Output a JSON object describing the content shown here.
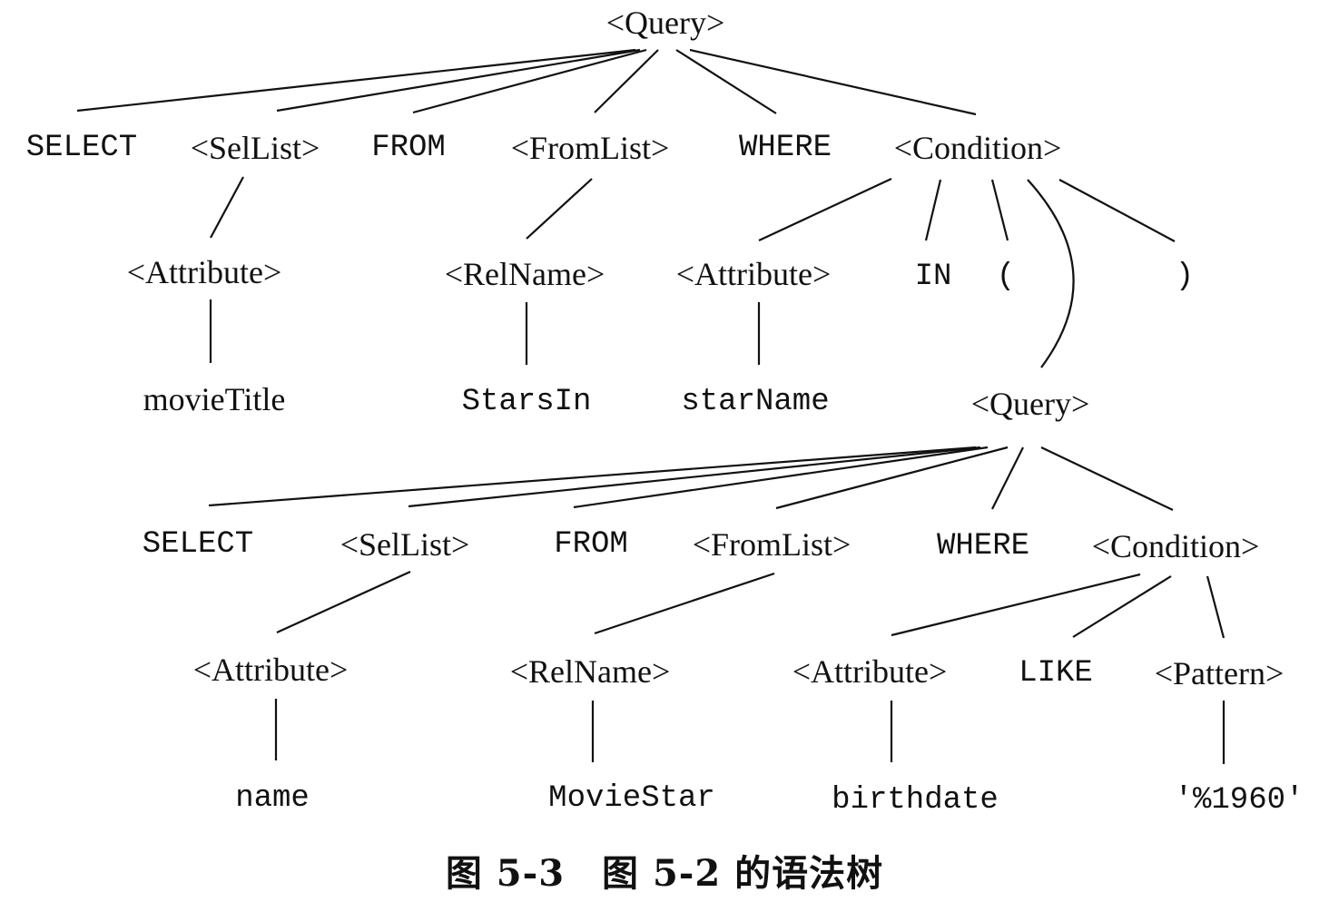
{
  "tree": {
    "nodes": [
      {
        "id": "q1",
        "text": "<Query>",
        "font": "serif"
      },
      {
        "id": "select1",
        "text": "SELECT",
        "font": "mono"
      },
      {
        "id": "sellist1",
        "text": "<SelList>",
        "font": "serif"
      },
      {
        "id": "from1",
        "text": "FROM",
        "font": "mono"
      },
      {
        "id": "fromlist1",
        "text": "<FromList>",
        "font": "serif"
      },
      {
        "id": "where1",
        "text": "WHERE",
        "font": "mono"
      },
      {
        "id": "cond1",
        "text": "<Condition>",
        "font": "serif"
      },
      {
        "id": "attr1",
        "text": "<Attribute>",
        "font": "serif"
      },
      {
        "id": "relname1",
        "text": "<RelName>",
        "font": "serif"
      },
      {
        "id": "attr2",
        "text": "<Attribute>",
        "font": "serif"
      },
      {
        "id": "in1",
        "text": "IN",
        "font": "mono"
      },
      {
        "id": "lparen",
        "text": "(",
        "font": "mono"
      },
      {
        "id": "rparen",
        "text": ")",
        "font": "mono"
      },
      {
        "id": "movietitle",
        "text": "movieTitle",
        "font": "serif"
      },
      {
        "id": "starsin",
        "text": "StarsIn",
        "font": "mono"
      },
      {
        "id": "starname",
        "text": "starName",
        "font": "mono"
      },
      {
        "id": "q2",
        "text": "<Query>",
        "font": "serif"
      },
      {
        "id": "select2",
        "text": "SELECT",
        "font": "mono"
      },
      {
        "id": "sellist2",
        "text": "<SelList>",
        "font": "serif"
      },
      {
        "id": "from2",
        "text": "FROM",
        "font": "mono"
      },
      {
        "id": "fromlist2",
        "text": "<FromList>",
        "font": "serif"
      },
      {
        "id": "where2",
        "text": "WHERE",
        "font": "mono"
      },
      {
        "id": "cond2",
        "text": "<Condition>",
        "font": "serif"
      },
      {
        "id": "attr3",
        "text": "<Attribute>",
        "font": "serif"
      },
      {
        "id": "relname2",
        "text": "<RelName>",
        "font": "serif"
      },
      {
        "id": "attr4",
        "text": "<Attribute>",
        "font": "serif"
      },
      {
        "id": "like1",
        "text": "LIKE",
        "font": "mono"
      },
      {
        "id": "pattern1",
        "text": "<Pattern>",
        "font": "serif"
      },
      {
        "id": "name1",
        "text": "name",
        "font": "mono"
      },
      {
        "id": "moviestar",
        "text": "MovieStar",
        "font": "mono"
      },
      {
        "id": "birthdate",
        "text": "birthdate",
        "font": "mono"
      },
      {
        "id": "patternval",
        "text": "'%1960'",
        "font": "mono"
      }
    ],
    "edges": [
      [
        "q1",
        "select1"
      ],
      [
        "q1",
        "sellist1"
      ],
      [
        "q1",
        "from1"
      ],
      [
        "q1",
        "fromlist1"
      ],
      [
        "q1",
        "where1"
      ],
      [
        "q1",
        "cond1"
      ],
      [
        "sellist1",
        "attr1"
      ],
      [
        "attr1",
        "movietitle"
      ],
      [
        "fromlist1",
        "relname1"
      ],
      [
        "relname1",
        "starsin"
      ],
      [
        "cond1",
        "attr2"
      ],
      [
        "cond1",
        "in1"
      ],
      [
        "cond1",
        "lparen"
      ],
      [
        "cond1",
        "q2"
      ],
      [
        "cond1",
        "rparen"
      ],
      [
        "attr2",
        "starname"
      ],
      [
        "q2",
        "select2"
      ],
      [
        "q2",
        "sellist2"
      ],
      [
        "q2",
        "from2"
      ],
      [
        "q2",
        "fromlist2"
      ],
      [
        "q2",
        "where2"
      ],
      [
        "q2",
        "cond2"
      ],
      [
        "sellist2",
        "attr3"
      ],
      [
        "attr3",
        "name1"
      ],
      [
        "fromlist2",
        "relname2"
      ],
      [
        "relname2",
        "moviestar"
      ],
      [
        "cond2",
        "attr4"
      ],
      [
        "cond2",
        "like1"
      ],
      [
        "cond2",
        "pattern1"
      ],
      [
        "attr4",
        "birthdate"
      ],
      [
        "pattern1",
        "patternval"
      ]
    ]
  },
  "caption": "图 5-3　图 5-2 的语法树"
}
